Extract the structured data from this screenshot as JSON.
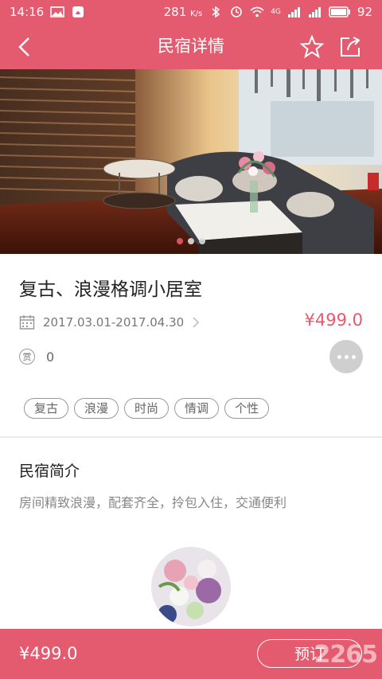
{
  "status_bar": {
    "time": "14:16",
    "net_speed": "281",
    "net_speed_unit": "K/s",
    "signal_4g": "4G",
    "battery": "92"
  },
  "header": {
    "title": "民宿详情"
  },
  "hero": {
    "dot_count": 3,
    "active_dot": 0
  },
  "listing": {
    "title": "复古、浪漫格调小居室",
    "date_range": "2017.03.01-2017.04.30",
    "price": "¥499.0",
    "reward_badge": "赏",
    "reward_count": "0",
    "tags": [
      "复古",
      "浪漫",
      "时尚",
      "情调",
      "个性"
    ]
  },
  "intro": {
    "title": "民宿简介",
    "text": "房间精致浪漫，配套齐全，拎包入住，交通便利"
  },
  "bottom_bar": {
    "price": "¥499.0",
    "book_label": "预订"
  },
  "watermark": "2265",
  "colors": {
    "accent": "#e45a6e"
  },
  "icons": [
    "back-icon",
    "star-icon",
    "share-icon",
    "calendar-icon",
    "chevron-right-icon",
    "more-icon"
  ]
}
